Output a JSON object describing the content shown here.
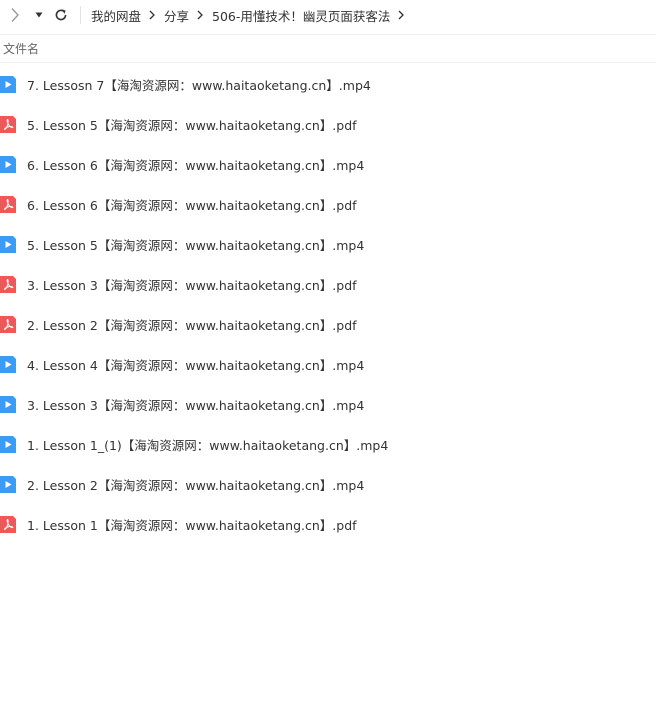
{
  "toolbar": {
    "icons": {
      "forward": "chevron-right-icon",
      "history": "caret-down-icon",
      "refresh": "refresh-icon"
    }
  },
  "breadcrumb": [
    "我的网盘",
    "分享",
    "506-用懂技术！幽灵页面获客法"
  ],
  "list_header": {
    "name_column": "文件名"
  },
  "colors": {
    "video_icon": "#3b9cf5",
    "pdf_icon": "#f0575b"
  },
  "files": [
    {
      "type": "video",
      "name": "7. Lessosn 7【海淘资源网：www.haitaoketang.cn】.mp4"
    },
    {
      "type": "pdf",
      "name": "5. Lesson 5【海淘资源网：www.haitaoketang.cn】.pdf"
    },
    {
      "type": "video",
      "name": "6. Lesson 6【海淘资源网：www.haitaoketang.cn】.mp4"
    },
    {
      "type": "pdf",
      "name": "6. Lesson 6【海淘资源网：www.haitaoketang.cn】.pdf"
    },
    {
      "type": "video",
      "name": "5. Lesson 5【海淘资源网：www.haitaoketang.cn】.mp4"
    },
    {
      "type": "pdf",
      "name": "3. Lesson 3【海淘资源网：www.haitaoketang.cn】.pdf"
    },
    {
      "type": "pdf",
      "name": "2. Lesson 2【海淘资源网：www.haitaoketang.cn】.pdf"
    },
    {
      "type": "video",
      "name": "4. Lesson 4【海淘资源网：www.haitaoketang.cn】.mp4"
    },
    {
      "type": "video",
      "name": "3. Lesson 3【海淘资源网：www.haitaoketang.cn】.mp4"
    },
    {
      "type": "video",
      "name": "1. Lesson 1_(1)【海淘资源网：www.haitaoketang.cn】.mp4"
    },
    {
      "type": "video",
      "name": "2. Lesson 2【海淘资源网：www.haitaoketang.cn】.mp4"
    },
    {
      "type": "pdf",
      "name": "1. Lesson 1【海淘资源网：www.haitaoketang.cn】.pdf"
    }
  ]
}
